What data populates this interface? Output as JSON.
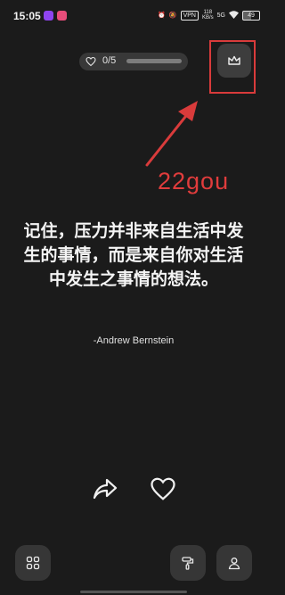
{
  "status_bar": {
    "time": "15:05",
    "vpn": "VPN",
    "speed_value": "118",
    "speed_unit": "KB/s",
    "network": "5G",
    "battery": "49"
  },
  "progress": {
    "text": "0/5",
    "fraction": 0
  },
  "annotation": {
    "text": "22gou",
    "color": "#e03c3c"
  },
  "quote": {
    "line1": "记住，压力并非来自生活中发",
    "line2": "生的事情，而是来自你对生活",
    "line3": "中发生之事情的想法。",
    "author": "-Andrew Bernstein"
  },
  "icons": {
    "premium": "crown-icon",
    "share": "share-arrow-icon",
    "like": "heart-icon",
    "categories": "grid-icon",
    "themes": "paint-roller-icon",
    "profile": "person-icon"
  },
  "colors": {
    "background": "#1b1b1b",
    "button": "#363636",
    "highlight": "#d93b3b"
  }
}
